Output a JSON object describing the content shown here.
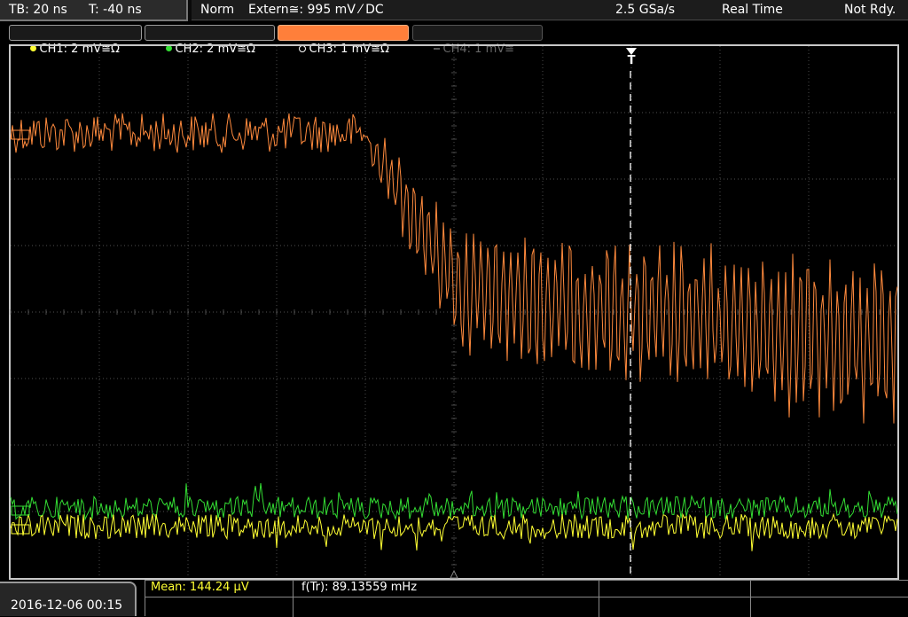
{
  "timebase": {
    "tb": "TB: 20 ns",
    "t": "T: -40 ns"
  },
  "trigger": {
    "mode": "Norm",
    "source": "Extern≅: 995 mV ⁄ DC",
    "sample_rate": "2.5 GSa/s",
    "acq_mode": "Real Time",
    "status": "Not Rdy."
  },
  "channels": [
    {
      "label": "CH1: 2 mV≅Ω",
      "color": "#ffff33",
      "active": true
    },
    {
      "label": "CH2: 2 mV≅Ω",
      "color": "#33dd33",
      "active": true
    },
    {
      "label": "CH3: 1 mV≅Ω",
      "color": "#ff8833",
      "active": true,
      "selected": true
    },
    {
      "label": "CH4: 1 mV≅",
      "color": "#666666",
      "active": false
    }
  ],
  "trigger_marker": "T",
  "datetime": "2016-12-06 00:15",
  "measurements": {
    "mean": "Mean: 144.24 µV",
    "freq": "f(Tr): 89.13559 mHz"
  },
  "colors": {
    "ch1": "#ffff33",
    "ch2": "#33dd33",
    "ch3": "#ff8a3d",
    "grid": "#6a6a6a",
    "frame": "#c8c8c8",
    "trigger_line": "#ffffff"
  },
  "icons": [
    "trigger-marker-icon",
    "channel-dot-icon",
    "level-marker-icon"
  ]
}
